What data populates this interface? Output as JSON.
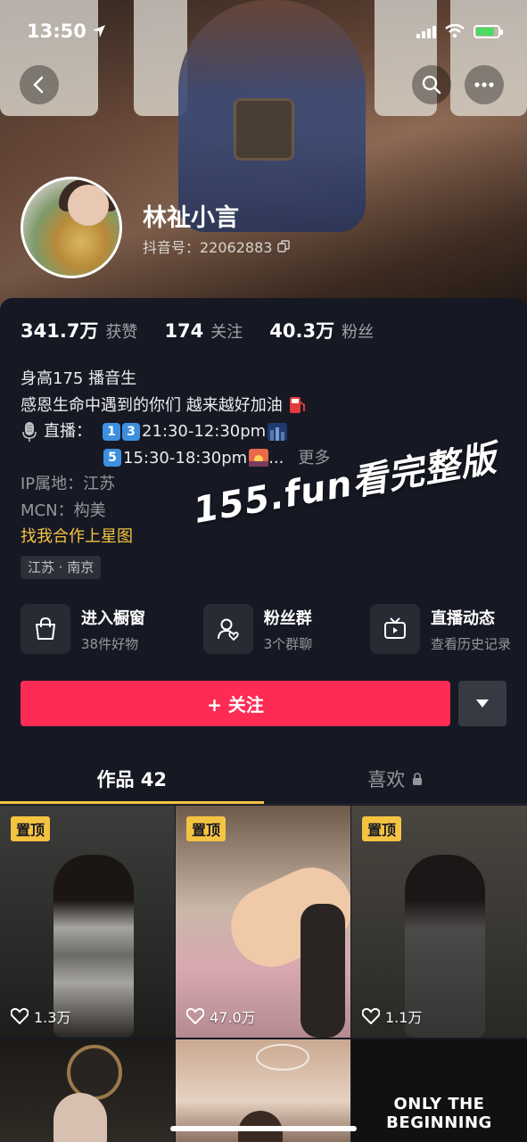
{
  "status_bar": {
    "time": "13:50"
  },
  "profile": {
    "nickname": "林祉小言",
    "douyin_id": "抖音号：22062883"
  },
  "stats": [
    {
      "value": "341.7万",
      "label": "获赞"
    },
    {
      "value": "174",
      "label": "关注"
    },
    {
      "value": "40.3万",
      "label": "粉丝"
    }
  ],
  "bio": {
    "line1": "身高175  播音生",
    "line2": "感恩生命中遇到的你们 越来越好加油",
    "live_prefix": "直播：",
    "live_badge_a": "1",
    "live_badge_b": "3",
    "live_time_1": "21:30-12:30pm",
    "live_badge_c": "5",
    "live_time_2": "15:30-18:30pm",
    "live_ellipsis": "...",
    "more": "更多",
    "ip": "IP属地：江苏",
    "mcn": "MCN：构美",
    "cooperation": "找我合作上星图",
    "location_tag": "江苏 · 南京"
  },
  "watermark": "155.fun看完整版",
  "features": [
    {
      "title": "进入橱窗",
      "sub": "38件好物",
      "icon": "shopping-bag-icon"
    },
    {
      "title": "粉丝群",
      "sub": "3个群聊",
      "icon": "fan-group-icon"
    },
    {
      "title": "直播动态",
      "sub": "查看历史记录",
      "icon": "tv-icon"
    }
  ],
  "follow_button": "+ 关注",
  "tabs": [
    {
      "label": "作品 42"
    },
    {
      "label": "喜欢"
    }
  ],
  "videos": [
    {
      "pinned": "置顶",
      "likes": "1.3万"
    },
    {
      "pinned": "置顶",
      "likes": "47.0万"
    },
    {
      "pinned": "置顶",
      "likes": "1.1万"
    },
    {
      "pinned": "",
      "likes": ""
    },
    {
      "pinned": "",
      "likes": ""
    },
    {
      "pinned": "",
      "likes": "",
      "overlay": "ONLY THE BEGINNING"
    }
  ],
  "colors": {
    "accent_red": "#fe2c55",
    "accent_gold": "#f5c342",
    "background": "#161823"
  }
}
